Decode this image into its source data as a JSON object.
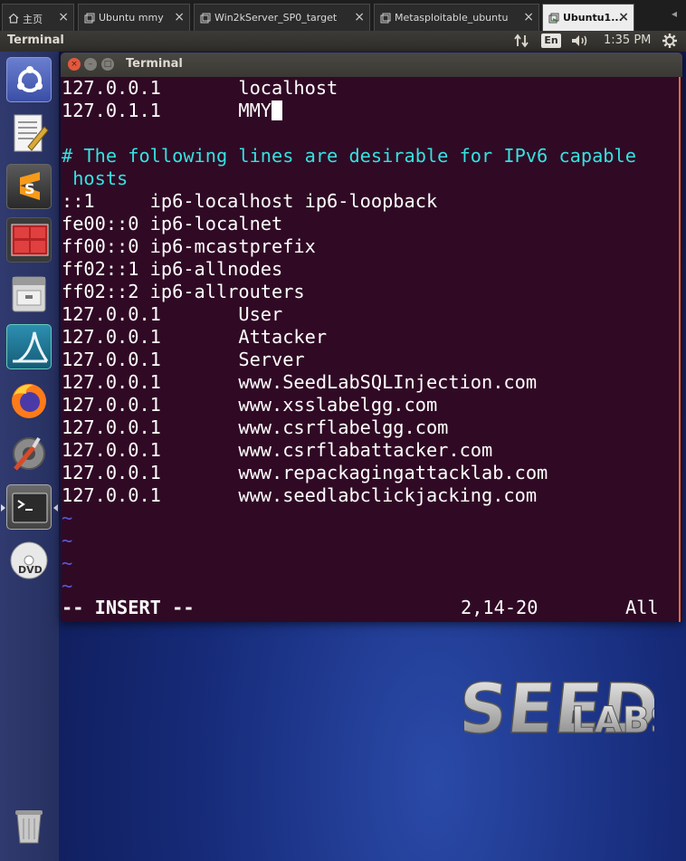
{
  "vm_tabs": [
    {
      "label": "主页",
      "active": false
    },
    {
      "label": "Ubuntu mmy",
      "active": false
    },
    {
      "label": "Win2kServer_SP0_target",
      "active": false
    },
    {
      "label": "Metasploitable_ubuntu",
      "active": false
    },
    {
      "label": "Ubuntu1...",
      "active": true
    }
  ],
  "panel": {
    "app_title": "Terminal",
    "language": "En",
    "time": "1:35 PM"
  },
  "launcher": {
    "items": [
      "ubuntu-dash",
      "text-editor",
      "sublime-text",
      "system-monitor",
      "files",
      "wireshark",
      "firefox",
      "system-settings",
      "terminal",
      "dvd"
    ],
    "trash": "trash"
  },
  "terminal": {
    "title": "Terminal",
    "lines": [
      {
        "text": "127.0.0.1       localhost",
        "kind": "normal"
      },
      {
        "text": "127.0.1.1       MMY",
        "kind": "cursor"
      },
      {
        "text": "",
        "kind": "normal"
      },
      {
        "text": "# The following lines are desirable for IPv6 capable",
        "kind": "comment"
      },
      {
        "text": " hosts",
        "kind": "comment"
      },
      {
        "text": "::1     ip6-localhost ip6-loopback",
        "kind": "normal"
      },
      {
        "text": "fe00::0 ip6-localnet",
        "kind": "normal"
      },
      {
        "text": "ff00::0 ip6-mcastprefix",
        "kind": "normal"
      },
      {
        "text": "ff02::1 ip6-allnodes",
        "kind": "normal"
      },
      {
        "text": "ff02::2 ip6-allrouters",
        "kind": "normal"
      },
      {
        "text": "127.0.0.1       User",
        "kind": "normal"
      },
      {
        "text": "127.0.0.1       Attacker",
        "kind": "normal"
      },
      {
        "text": "127.0.0.1       Server",
        "kind": "normal"
      },
      {
        "text": "127.0.0.1       www.SeedLabSQLInjection.com",
        "kind": "normal"
      },
      {
        "text": "127.0.0.1       www.xsslabelgg.com",
        "kind": "normal"
      },
      {
        "text": "127.0.0.1       www.csrflabelgg.com",
        "kind": "normal"
      },
      {
        "text": "127.0.0.1       www.csrflabattacker.com",
        "kind": "normal"
      },
      {
        "text": "127.0.0.1       www.repackagingattacklab.com",
        "kind": "normal"
      },
      {
        "text": "127.0.0.1       www.seedlabclickjacking.com",
        "kind": "normal"
      },
      {
        "text": "~",
        "kind": "tilde"
      },
      {
        "text": "~",
        "kind": "tilde"
      },
      {
        "text": "~",
        "kind": "tilde"
      },
      {
        "text": "~",
        "kind": "tilde"
      }
    ],
    "status_mode": "-- INSERT --",
    "status_position": "2,14-20",
    "status_scroll": "All"
  },
  "wallpaper": {
    "logo_main": "SEED",
    "logo_sub": "LABS"
  },
  "colors": {
    "terminal_bg": "#300a24",
    "comment": "#34e2e2",
    "tilde": "#5a5ad8",
    "desktop": "#162a78"
  }
}
